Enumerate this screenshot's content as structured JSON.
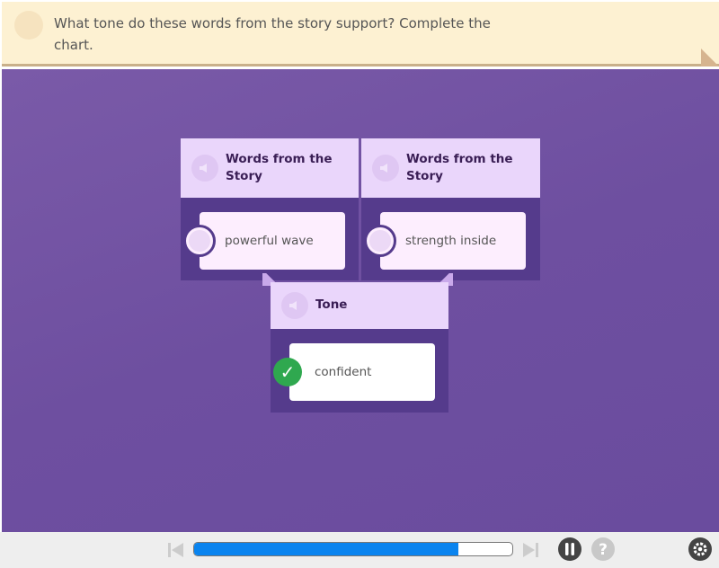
{
  "prompt": {
    "question": "What tone do these words from the story support? Complete the chart.",
    "audio_icon": "speaker-icon"
  },
  "chart": {
    "columns": [
      {
        "header": "Words from the Story",
        "answer": "powerful wave"
      },
      {
        "header": "Words from the Story",
        "answer": "strength inside"
      }
    ],
    "result": {
      "header": "Tone",
      "answer": "confident",
      "status": "correct"
    }
  },
  "player": {
    "progress_percent": 83,
    "controls": [
      "skip-back-icon",
      "skip-forward-icon",
      "pause-icon",
      "help-icon",
      "settings-icon"
    ],
    "progress_color": "#0a84ef"
  },
  "colors": {
    "background": "#6e4fa0",
    "header": "#ead6fb",
    "column": "#553b8c",
    "banner": "#fdf1d2",
    "correct": "#2fa84f"
  }
}
